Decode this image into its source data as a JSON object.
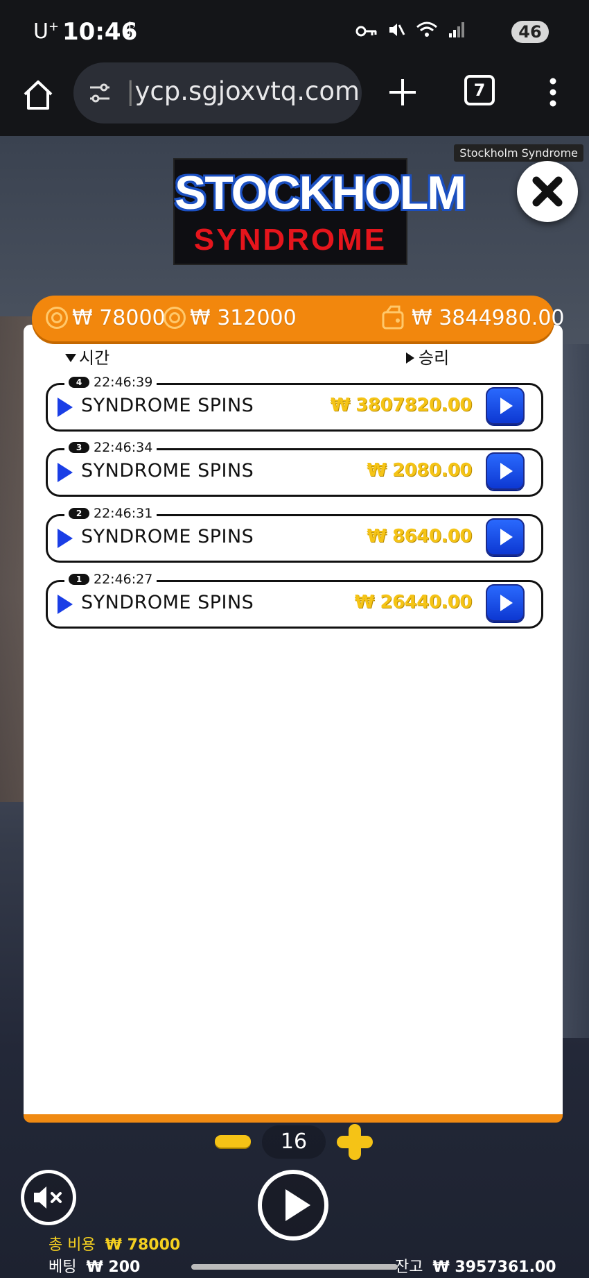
{
  "status_bar": {
    "carrier": "U",
    "carrier_sup": "+",
    "time": "10:46",
    "battery": "46"
  },
  "browser": {
    "url_cursor": "|",
    "url": "ycp.sgjoxvtq.com",
    "tab_count": "7"
  },
  "game": {
    "tooltip": "Stockholm Syndrome",
    "logo_line1": "STOCKHOLM",
    "logo_line2": "SYNDROME",
    "stats": {
      "coin1": "₩ 78000",
      "coin2": "₩ 312000",
      "wallet": "₩ 3844980.00"
    },
    "columns": {
      "time": "시간",
      "win": "승리"
    },
    "history": [
      {
        "badge": "4",
        "time": "22:46:39",
        "label": "SYNDROME SPINS",
        "win": "₩ 3807820.00"
      },
      {
        "badge": "3",
        "time": "22:46:34",
        "label": "SYNDROME SPINS",
        "win": "₩ 2080.00"
      },
      {
        "badge": "2",
        "time": "22:46:31",
        "label": "SYNDROME SPINS",
        "win": "₩ 8640.00"
      },
      {
        "badge": "1",
        "time": "22:46:27",
        "label": "SYNDROME SPINS",
        "win": "₩ 26440.00"
      }
    ],
    "controls": {
      "count": "16"
    },
    "footer": {
      "total_cost_label": "총 비용",
      "total_cost_value": "₩ 78000",
      "bet_label": "베팅",
      "bet_value": "₩ 200",
      "balance_label": "잔고",
      "balance_value": "₩ 3957361.00"
    }
  },
  "colors": {
    "accent_orange": "#f2870d",
    "win_gold": "#f5c416",
    "replay_blue": "#1a3ee6"
  }
}
